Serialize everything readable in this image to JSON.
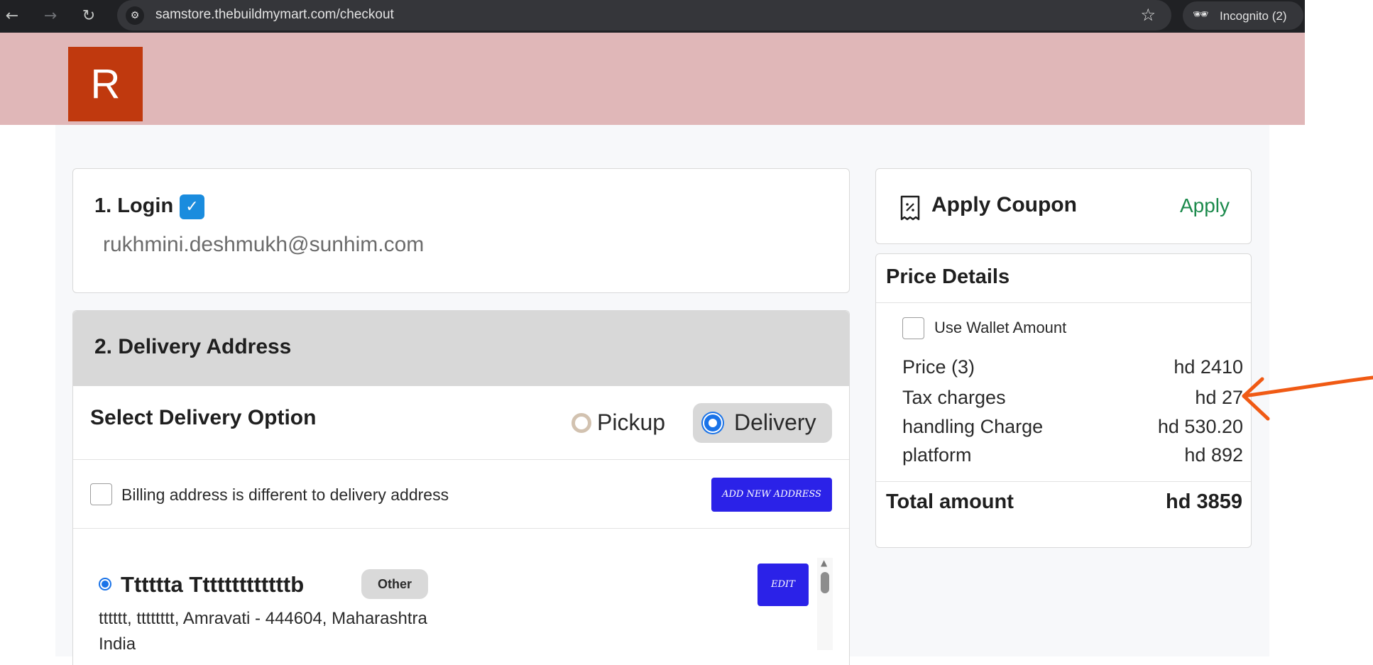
{
  "browser": {
    "url": "samstore.thebuildmymart.com/checkout",
    "incognito_label": "Incognito (2)"
  },
  "header": {
    "logo_text": "R",
    "logo_color": "#c0390e",
    "background_color": "#e0b7b8"
  },
  "login": {
    "title": "1. Login",
    "email": "rukhmini.deshmukh@sunhim.com",
    "verified": true
  },
  "delivery": {
    "title": "2. Delivery Address",
    "option_title": "Select Delivery Option",
    "options": [
      {
        "label": "Pickup",
        "selected": false
      },
      {
        "label": "Delivery",
        "selected": true
      }
    ],
    "billing_label": "Billing address is different to delivery address",
    "billing_checked": false,
    "add_button": "ADD NEW ADDRESS",
    "address": {
      "name": "Tttttta Tttttttttttttb",
      "tag": "Other",
      "line1": "tttttt, tttttttt, Amravati - 444604, Maharashtra",
      "line2": "India",
      "edit_button": "EDIT",
      "selected": true
    }
  },
  "coupon": {
    "title": "Apply Coupon",
    "action": "Apply",
    "action_color": "#1c8a4c"
  },
  "price_details": {
    "title": "Price Details",
    "wallet_label": "Use Wallet Amount",
    "wallet_checked": false,
    "rows": [
      {
        "label": "Price (3)",
        "value": "hd 2410"
      },
      {
        "label": "Tax charges",
        "value": "hd 27"
      },
      {
        "label": "handling Charge",
        "value": "hd 530.20"
      },
      {
        "label": "platform",
        "value": "hd 892"
      }
    ],
    "total_label": "Total amount",
    "total_value": "hd 3859"
  },
  "annotation": {
    "type": "arrow",
    "color": "#f05a14",
    "points_to": "Tax charges value"
  },
  "colors": {
    "primary_button": "#2b22e8",
    "checkbox_checked": "#1a8cde",
    "section_header": "#d8d8d8"
  }
}
